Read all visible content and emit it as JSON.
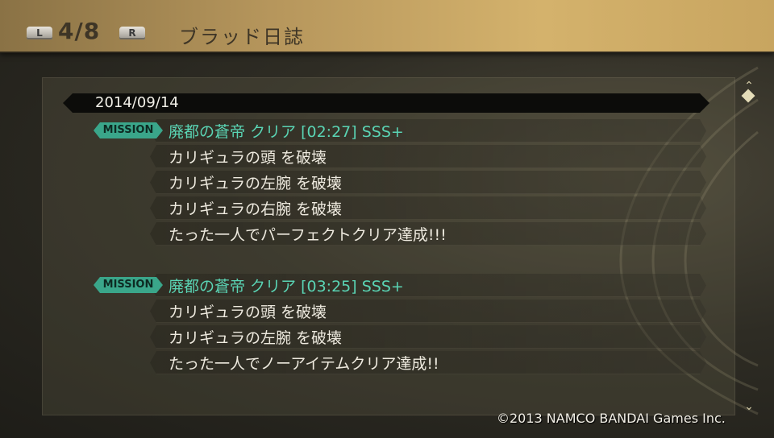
{
  "header": {
    "shoulder_left": "L",
    "shoulder_right": "R",
    "page": "4/8",
    "title": "ブラッド日誌"
  },
  "log": {
    "date": "2014/09/14",
    "entries": [
      {
        "tag": "MISSION",
        "title": "廃都の蒼帝 クリア [02:27] SSS+",
        "details": [
          "カリギュラの頭 を破壊",
          "カリギュラの左腕 を破壊",
          "カリギュラの右腕 を破壊",
          "たった一人でパーフェクトクリア達成!!!"
        ]
      },
      {
        "tag": "MISSION",
        "title": "廃都の蒼帝 クリア [03:25] SSS+",
        "details": [
          "カリギュラの頭 を破壊",
          "カリギュラの左腕 を破壊",
          "たった一人でノーアイテムクリア達成!!"
        ]
      }
    ]
  },
  "scrollbar": {
    "up": "⌃",
    "down": "⌄"
  },
  "copyright": "©2013 NAMCO BANDAI Games Inc.",
  "colors": {
    "mission_accent": "#3aa68a",
    "mission_title": "#5ad4b4",
    "header_gold": "#c8a560"
  }
}
